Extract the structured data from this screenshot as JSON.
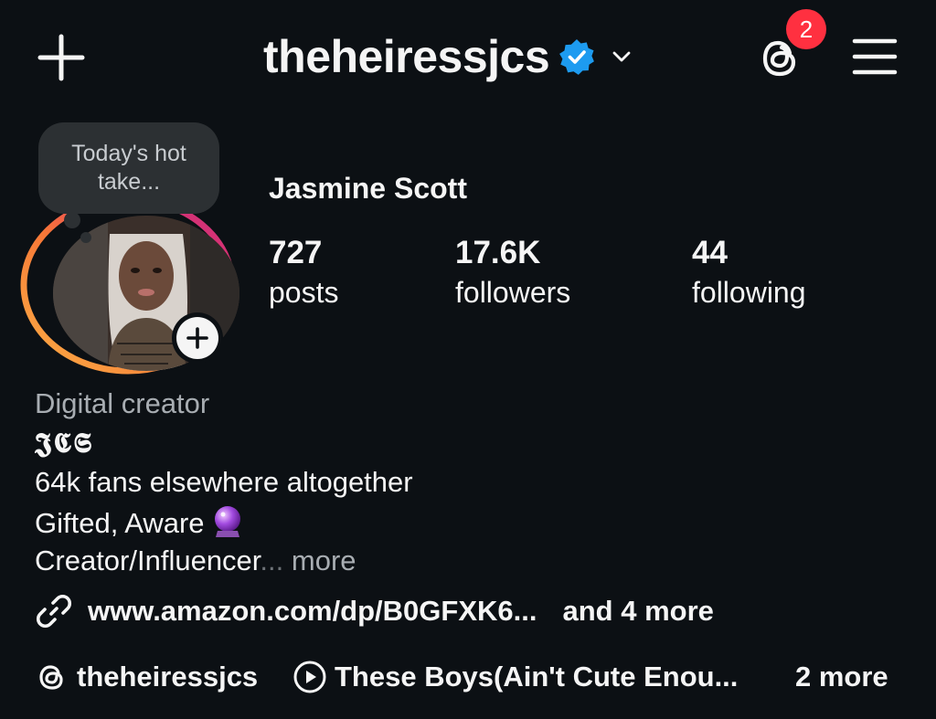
{
  "header": {
    "username": "theheiressjcs",
    "notification_count": "2"
  },
  "note": {
    "text_line1": "Today's hot",
    "text_line2": "take..."
  },
  "profile": {
    "full_name": "Jasmine Scott",
    "stats": [
      {
        "value": "727",
        "label": "posts"
      },
      {
        "value": "17.6K",
        "label": "followers"
      },
      {
        "value": "44",
        "label": "following"
      }
    ]
  },
  "bio": {
    "category": "Digital creator",
    "ornate_initials": "𝕵𝕮𝕾",
    "line1": "64k fans elsewhere altogether",
    "line2": "Gifted, Aware",
    "line3": "Creator/Influencer",
    "ellipsis": "...",
    "more_label": "more"
  },
  "links": {
    "primary_url": "www.amazon.com/dp/B0GFXK6...",
    "more_label": "and 4 more"
  },
  "bottom_row": {
    "threads_handle": "theheiressjcs",
    "music_title": "These Boys(Ain't Cute Enou...",
    "more_label": "2 more"
  },
  "colors": {
    "background": "#0c1014",
    "badge": "#ff3040",
    "verified": "#1d9bf0",
    "muted_text": "#a8adb2"
  }
}
